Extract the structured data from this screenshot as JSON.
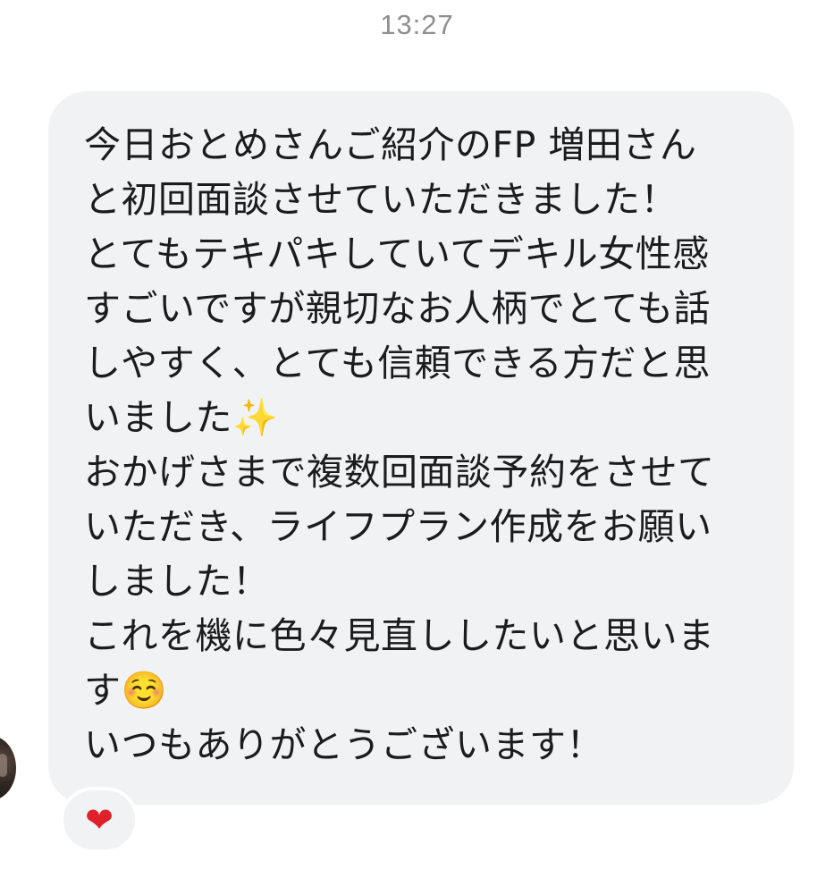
{
  "header": {
    "timestamp": "13:27"
  },
  "message": {
    "lines": [
      "今日おとめさんご紹介のFP 増田さん",
      "と初回面談させていただきました！",
      "とてもテキパキしていてデキル女性感",
      "すごいですが親切なお人柄でとても話",
      "しやすく、とても信頼できる方だと思",
      "いました✨",
      "おかげさまで複数回面談予約をさせて",
      "いただき、ライフプラン作成をお願い",
      "しました！",
      "これを機に色々見直ししたいと思いま",
      "す☺️",
      "いつもありがとうございます！"
    ]
  },
  "reaction": {
    "emoji": "❤",
    "icon": "heart-icon",
    "color": "#e0202a"
  },
  "colors": {
    "bubble": "#f1f2f4",
    "text": "#1c1c1e",
    "timestamp": "#8e8e93"
  }
}
